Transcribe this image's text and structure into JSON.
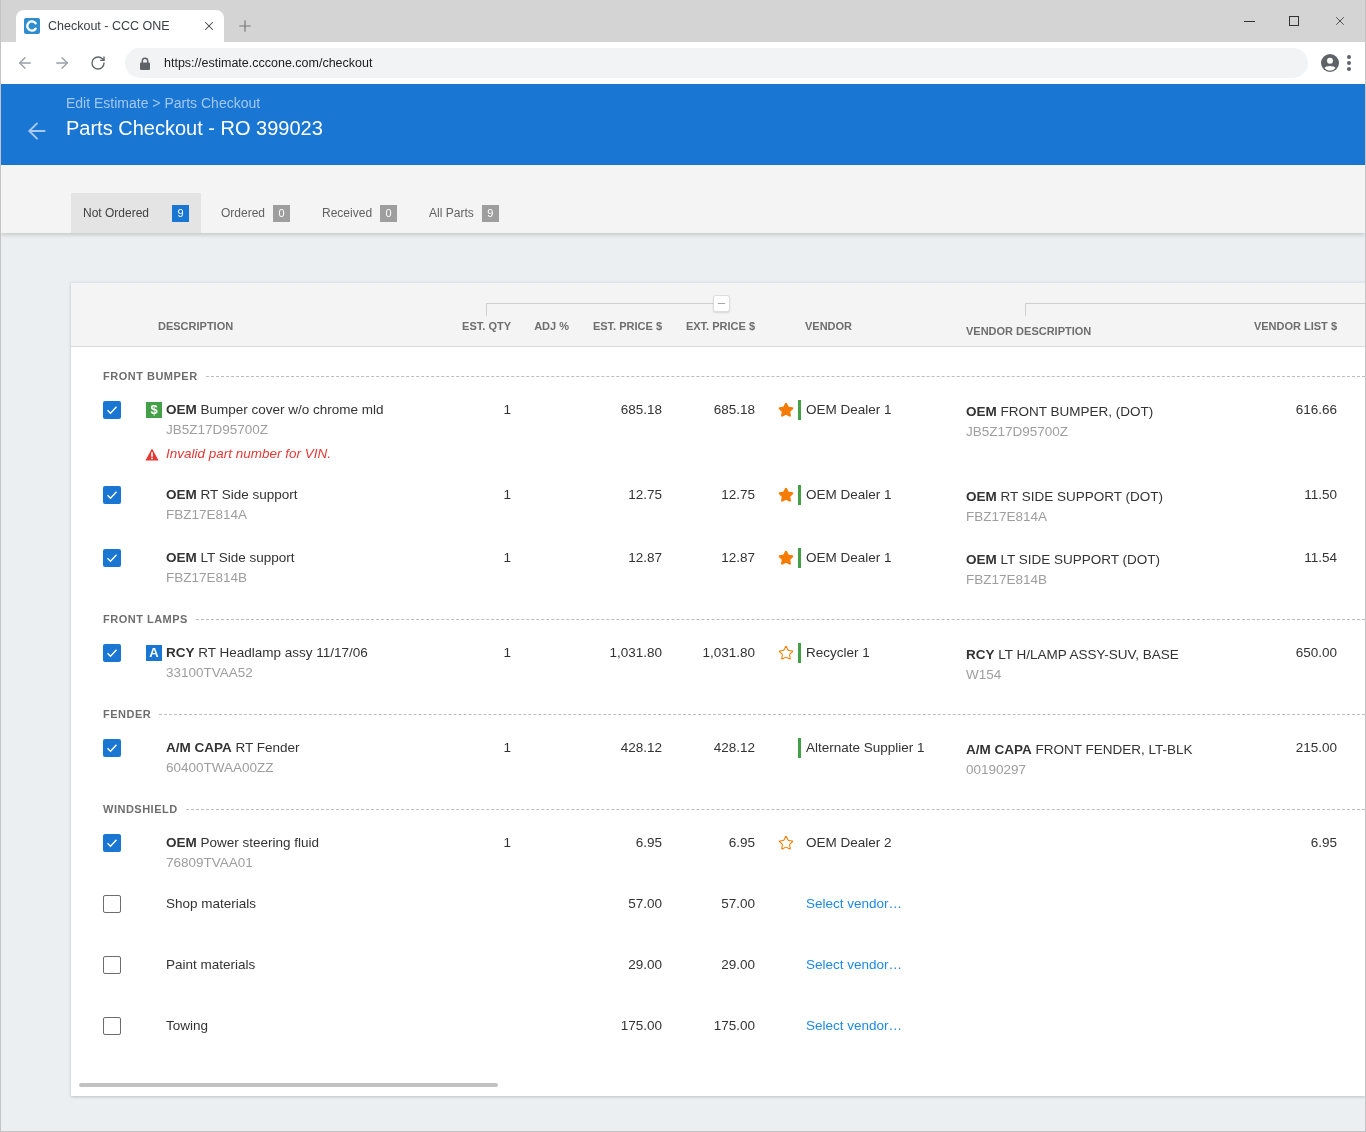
{
  "browser": {
    "tab_title": "Checkout - CCC ONE",
    "url": "https://estimate.cccone.com/checkout"
  },
  "header": {
    "breadcrumb": "Edit Estimate > Parts Checkout",
    "title": "Parts Checkout - RO 399023"
  },
  "tabs": [
    {
      "label": "Not Ordered",
      "count": "9",
      "selected": true
    },
    {
      "label": "Ordered",
      "count": "0",
      "selected": false
    },
    {
      "label": "Received",
      "count": "0",
      "selected": false
    },
    {
      "label": "All Parts",
      "count": "9",
      "selected": false
    }
  ],
  "table": {
    "columns": [
      "DESCRIPTION",
      "EST. QTY",
      "ADJ %",
      "EST. PRICE $",
      "EXT. PRICE $",
      "VENDOR",
      "VENDOR DESCRIPTION",
      "VENDOR LIST $"
    ],
    "groups": [
      {
        "name": "FRONT BUMPER",
        "rows": [
          {
            "checked": true,
            "badge": {
              "kind": "price",
              "text": "$"
            },
            "description": "**OEM** Bumper cover w/o chrome mld",
            "part_number": "JB5Z17D95700Z",
            "warning": "Invalid part number for VIN.",
            "qty": "1",
            "est_price": "685.18",
            "ext_price": "685.18",
            "vendor": {
              "kind": "dealer",
              "name": "OEM Dealer 1",
              "preferred": true,
              "marker": true
            },
            "vendor_description": "**OEM** FRONT BUMPER, (DOT)",
            "vendor_part_number": "JB5Z17D95700Z",
            "vendor_list": "616.66"
          },
          {
            "checked": true,
            "description": "**OEM** RT Side support",
            "part_number": "FBZ17E814A",
            "qty": "1",
            "est_price": "12.75",
            "ext_price": "12.75",
            "vendor": {
              "kind": "dealer",
              "name": "OEM Dealer 1",
              "preferred": true,
              "marker": true
            },
            "vendor_description": "**OEM** RT SIDE SUPPORT (DOT)",
            "vendor_part_number": "FBZ17E814A",
            "vendor_list": "11.50"
          },
          {
            "checked": true,
            "description": "**OEM** LT Side support",
            "part_number": "FBZ17E814B",
            "qty": "1",
            "est_price": "12.87",
            "ext_price": "12.87",
            "vendor": {
              "kind": "dealer",
              "name": "OEM Dealer 1",
              "preferred": true,
              "marker": true
            },
            "vendor_description": "**OEM** LT SIDE SUPPORT (DOT)",
            "vendor_part_number": "FBZ17E814B",
            "vendor_list": "11.54"
          }
        ]
      },
      {
        "name": "FRONT LAMPS",
        "rows": [
          {
            "checked": true,
            "badge": {
              "kind": "alternate",
              "text": "A"
            },
            "description": "**RCY** RT Headlamp assy 11/17/06",
            "part_number": "33100TVAA52",
            "qty": "1",
            "est_price": "1,031.80",
            "ext_price": "1,031.80",
            "vendor": {
              "kind": "dealer",
              "name": "Recycler 1",
              "preferred": false,
              "marker": true
            },
            "vendor_description": "**RCY** LT H/LAMP ASSY-SUV, BASE",
            "vendor_part_number": "W154",
            "vendor_list": "650.00"
          }
        ]
      },
      {
        "name": "FENDER",
        "rows": [
          {
            "checked": true,
            "description": "**A/M CAPA** RT Fender",
            "part_number": "60400TWAA00ZZ",
            "qty": "1",
            "est_price": "428.12",
            "ext_price": "428.12",
            "vendor": {
              "kind": "supplier",
              "name": "Alternate Supplier 1",
              "marker": true
            },
            "vendor_description": "**A/M CAPA** FRONT FENDER, LT-BLK",
            "vendor_part_number": "00190297",
            "vendor_list": "215.00"
          }
        ]
      },
      {
        "name": "WINDSHIELD",
        "rows": [
          {
            "checked": true,
            "description": "**OEM** Power steering fluid",
            "part_number": "76809TVAA01",
            "qty": "1",
            "est_price": "6.95",
            "ext_price": "6.95",
            "vendor": {
              "kind": "dealer",
              "name": "OEM Dealer 2",
              "preferred": false,
              "marker": false
            },
            "vendor_list": "6.95"
          },
          {
            "checked": false,
            "description": "Shop materials",
            "est_price": "57.00",
            "ext_price": "57.00",
            "vendor": {
              "kind": "link",
              "label": "Select vendor…"
            }
          },
          {
            "checked": false,
            "description": "Paint materials",
            "est_price": "29.00",
            "ext_price": "29.00",
            "vendor": {
              "kind": "link",
              "label": "Select vendor…"
            }
          },
          {
            "checked": false,
            "description": "Towing",
            "est_price": "175.00",
            "ext_price": "175.00",
            "vendor": {
              "kind": "link",
              "label": "Select vendor…"
            }
          }
        ]
      }
    ]
  }
}
